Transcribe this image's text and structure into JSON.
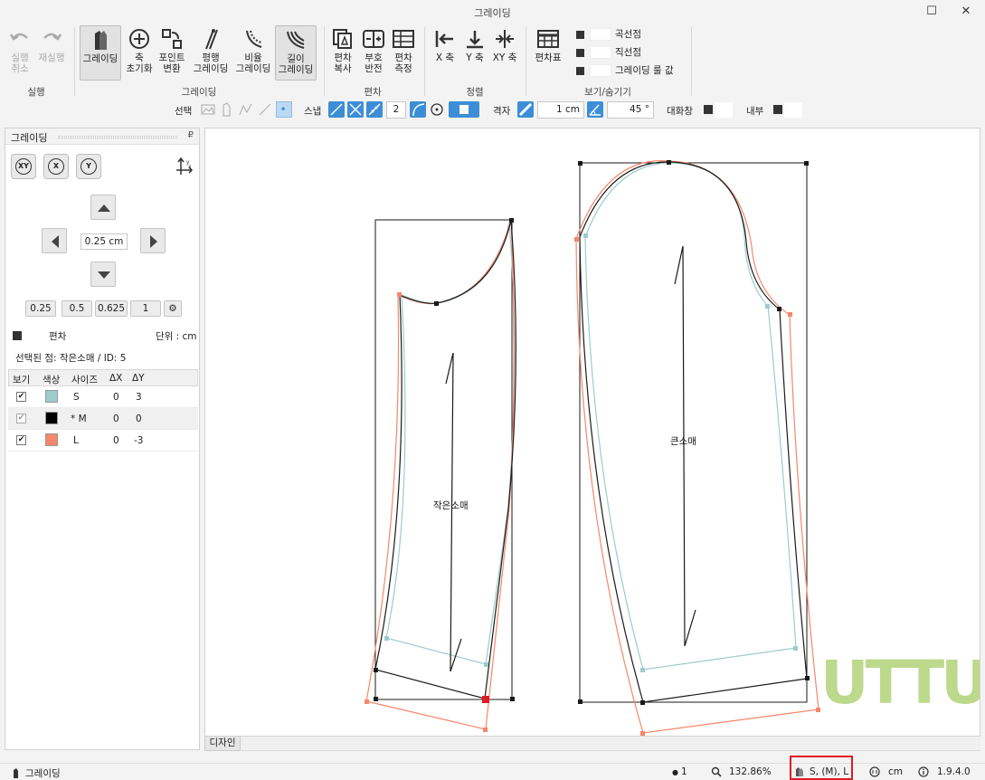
{
  "window": {
    "title": "그레이딩",
    "maximize_glyph": "☐",
    "close_glyph": "✕"
  },
  "ribbon": {
    "run": {
      "undo": "실행\n취소",
      "redo": "재실행",
      "group": "실행"
    },
    "grading": {
      "group": "그레이딩",
      "buttons": [
        {
          "label": "그레이딩"
        },
        {
          "label": "축\n초기화"
        },
        {
          "label": "포인트\n변환"
        },
        {
          "label": "평행\n그레이딩"
        },
        {
          "label": "비율\n그레이딩"
        },
        {
          "label": "길이\n그레이딩"
        }
      ]
    },
    "deviation": {
      "group": "편차",
      "buttons": [
        {
          "label": "편차\n복사"
        },
        {
          "label": "부호\n반전"
        },
        {
          "label": "편차\n측정"
        }
      ]
    },
    "align": {
      "group": "정렬",
      "buttons": [
        {
          "label": "X 축"
        },
        {
          "label": "Y 축"
        },
        {
          "label": "XY 축"
        }
      ]
    },
    "view": {
      "group": "보기/숨기기",
      "table_button": "편차표",
      "checks": [
        "곡선점",
        "직선점",
        "그레이딩 룰 값"
      ]
    }
  },
  "optionbar": {
    "select_label": "선택",
    "snap_label": "스냅",
    "snap_count": "2",
    "grid_label": "격자",
    "grid_value": "1 cm",
    "angle_value": "45 °",
    "dialog_label": "대화창",
    "inner_label": "내부"
  },
  "panel": {
    "title": "그레이딩",
    "pin_glyph": "₽",
    "axis_buttons": [
      "XY",
      "X",
      "Y"
    ],
    "step_value": "0.25 cm",
    "presets": [
      "0.25",
      "0.5",
      "0.625",
      "1"
    ],
    "preset_settings_glyph": "⚙",
    "deviation_label": "편차",
    "unit_label": "단위 : cm",
    "selected_point": "선택된 점: 작은소매 / ID: 5",
    "table": {
      "headers": [
        "보기",
        "색상",
        "사이즈",
        "ΔX",
        "ΔY"
      ],
      "rows": [
        {
          "check": "✔",
          "color": "#9ccccc",
          "size": "S",
          "dx": "0",
          "dy": "3"
        },
        {
          "check": "✔",
          "color": "#000000",
          "size": "* M",
          "dx": "0",
          "dy": "0"
        },
        {
          "check": "✔",
          "color": "#f5876a",
          "size": "L",
          "dx": "0",
          "dy": "-3"
        }
      ]
    }
  },
  "canvas": {
    "pattern_small": "작은소매",
    "pattern_large": "큰소매",
    "colors": {
      "base": "#1a1a1a",
      "small": "#9ccccc",
      "large": "#f5876a",
      "selected_point": "#e01b24"
    },
    "watermark": "UTTU"
  },
  "tabs": {
    "design": "디자인"
  },
  "status": {
    "mode": "그레이딩",
    "selection_count": "1",
    "zoom": "132.86%",
    "sizes": "S, (M), L",
    "unit": "cm",
    "version": "1.9.4.0"
  }
}
